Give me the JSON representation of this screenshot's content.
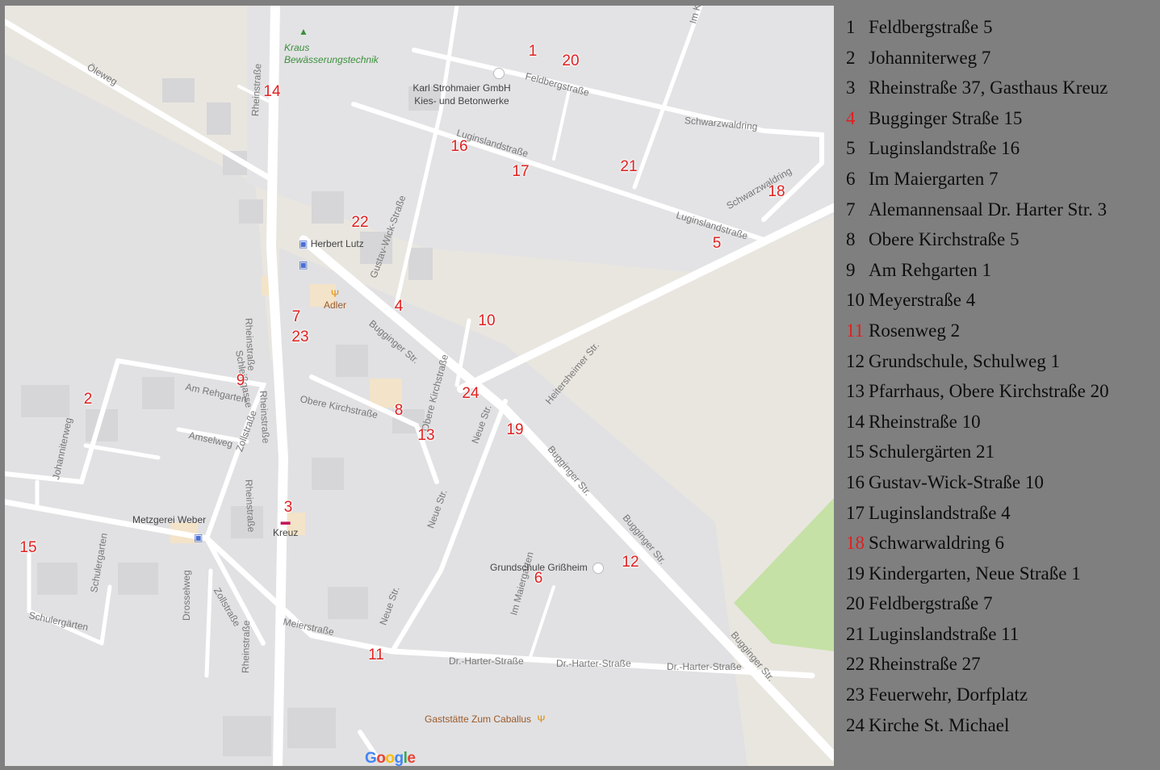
{
  "map": {
    "streets": [
      {
        "name": "Öleweg"
      },
      {
        "name": "Rheinstraße"
      },
      {
        "name": "Feldbergstraße"
      },
      {
        "name": "Schwarzwaldring"
      },
      {
        "name": "Luginslandstraße"
      },
      {
        "name": "Gustav-Wick-Straße"
      },
      {
        "name": "Bugginger Str."
      },
      {
        "name": "Heitersheimer Str."
      },
      {
        "name": "Am Rehgarten"
      },
      {
        "name": "Amselweg"
      },
      {
        "name": "Johanniterweg"
      },
      {
        "name": "Zollstraße"
      },
      {
        "name": "Schleißgasse"
      },
      {
        "name": "Obere Kirchstraße"
      },
      {
        "name": "Neue Str."
      },
      {
        "name": "Schulergarten"
      },
      {
        "name": "Schulergärten"
      },
      {
        "name": "Drosselweg"
      },
      {
        "name": "Meierstraße"
      },
      {
        "name": "Im Maiergarten"
      },
      {
        "name": "Dr.-Harter-Straße"
      },
      {
        "name": "Im K"
      }
    ],
    "pois": [
      {
        "name": "Kraus Bewässerungstechnik",
        "icon": "tree-icon"
      },
      {
        "name": "Karl Strohmaier GmbH Kies- und Betonwerke",
        "icon": "building-icon"
      },
      {
        "name": "Herbert Lutz",
        "icon": "shopping-bag-icon"
      },
      {
        "name": "Adler",
        "icon": "fork-knife-icon"
      },
      {
        "name": "Metzgerei Weber",
        "icon": "shopping-bag-icon"
      },
      {
        "name": "Kreuz",
        "icon": "bed-icon"
      },
      {
        "name": "Grundschule Grißheim",
        "icon": "building-icon"
      },
      {
        "name": "Gaststätte Zum Caballus",
        "icon": "fork-knife-icon"
      }
    ],
    "markers": [
      "1",
      "2",
      "3",
      "4",
      "5",
      "6",
      "7",
      "8",
      "9",
      "10",
      "11",
      "12",
      "13",
      "14",
      "15",
      "16",
      "17",
      "18",
      "19",
      "20",
      "21",
      "22",
      "23",
      "24"
    ],
    "google_logo": "Google",
    "colors": {
      "marker": "#e02020",
      "background": "#e8e8e8",
      "road": "#ffffff",
      "legend_bg": "#7f7f7f",
      "park": "#c5e1a5"
    }
  },
  "legend": [
    {
      "num": "1",
      "text": "Feldbergstraße 5",
      "red": false
    },
    {
      "num": "2",
      "text": "Johanniterweg 7",
      "red": false
    },
    {
      "num": "3",
      "text": "Rheinstraße 37, Gasthaus Kreuz",
      "red": false
    },
    {
      "num": "4",
      "text": "Bugginger Straße 15",
      "red": true
    },
    {
      "num": "5",
      "text": "Luginslandstraße 16",
      "red": false
    },
    {
      "num": "6",
      "text": "Im Maiergarten 7",
      "red": false
    },
    {
      "num": "7",
      "text": "Alemannensaal Dr. Harter Str. 3",
      "red": false
    },
    {
      "num": "8",
      "text": "Obere Kirchstraße 5",
      "red": false
    },
    {
      "num": "9",
      "text": "Am Rehgarten 1",
      "red": false
    },
    {
      "num": "10",
      "text": "Meyerstraße 4",
      "red": false
    },
    {
      "num": "11",
      "text": "Rosenweg 2",
      "red": true
    },
    {
      "num": "12",
      "text": "Grundschule, Schulweg 1",
      "red": false
    },
    {
      "num": "13",
      "text": "Pfarrhaus, Obere Kirchstraße 20",
      "red": false
    },
    {
      "num": "14",
      "text": "Rheinstraße 10",
      "red": false
    },
    {
      "num": "15",
      "text": "Schulergärten 21",
      "red": false
    },
    {
      "num": "16",
      "text": "Gustav-Wick-Straße 10",
      "red": false
    },
    {
      "num": "17",
      "text": "Luginslandstraße 4",
      "red": false
    },
    {
      "num": "18",
      "text": "Schwarwaldring 6",
      "red": true
    },
    {
      "num": "19",
      "text": "Kindergarten, Neue Straße 1",
      "red": false
    },
    {
      "num": "20",
      "text": "Feldbergstraße 7",
      "red": false
    },
    {
      "num": "21",
      "text": "Luginslandstraße 11",
      "red": false
    },
    {
      "num": "22",
      "text": "Rheinstraße 27",
      "red": false
    },
    {
      "num": "23",
      "text": "Feuerwehr, Dorfplatz",
      "red": false
    },
    {
      "num": "24",
      "text": "Kirche St. Michael",
      "red": false
    }
  ]
}
